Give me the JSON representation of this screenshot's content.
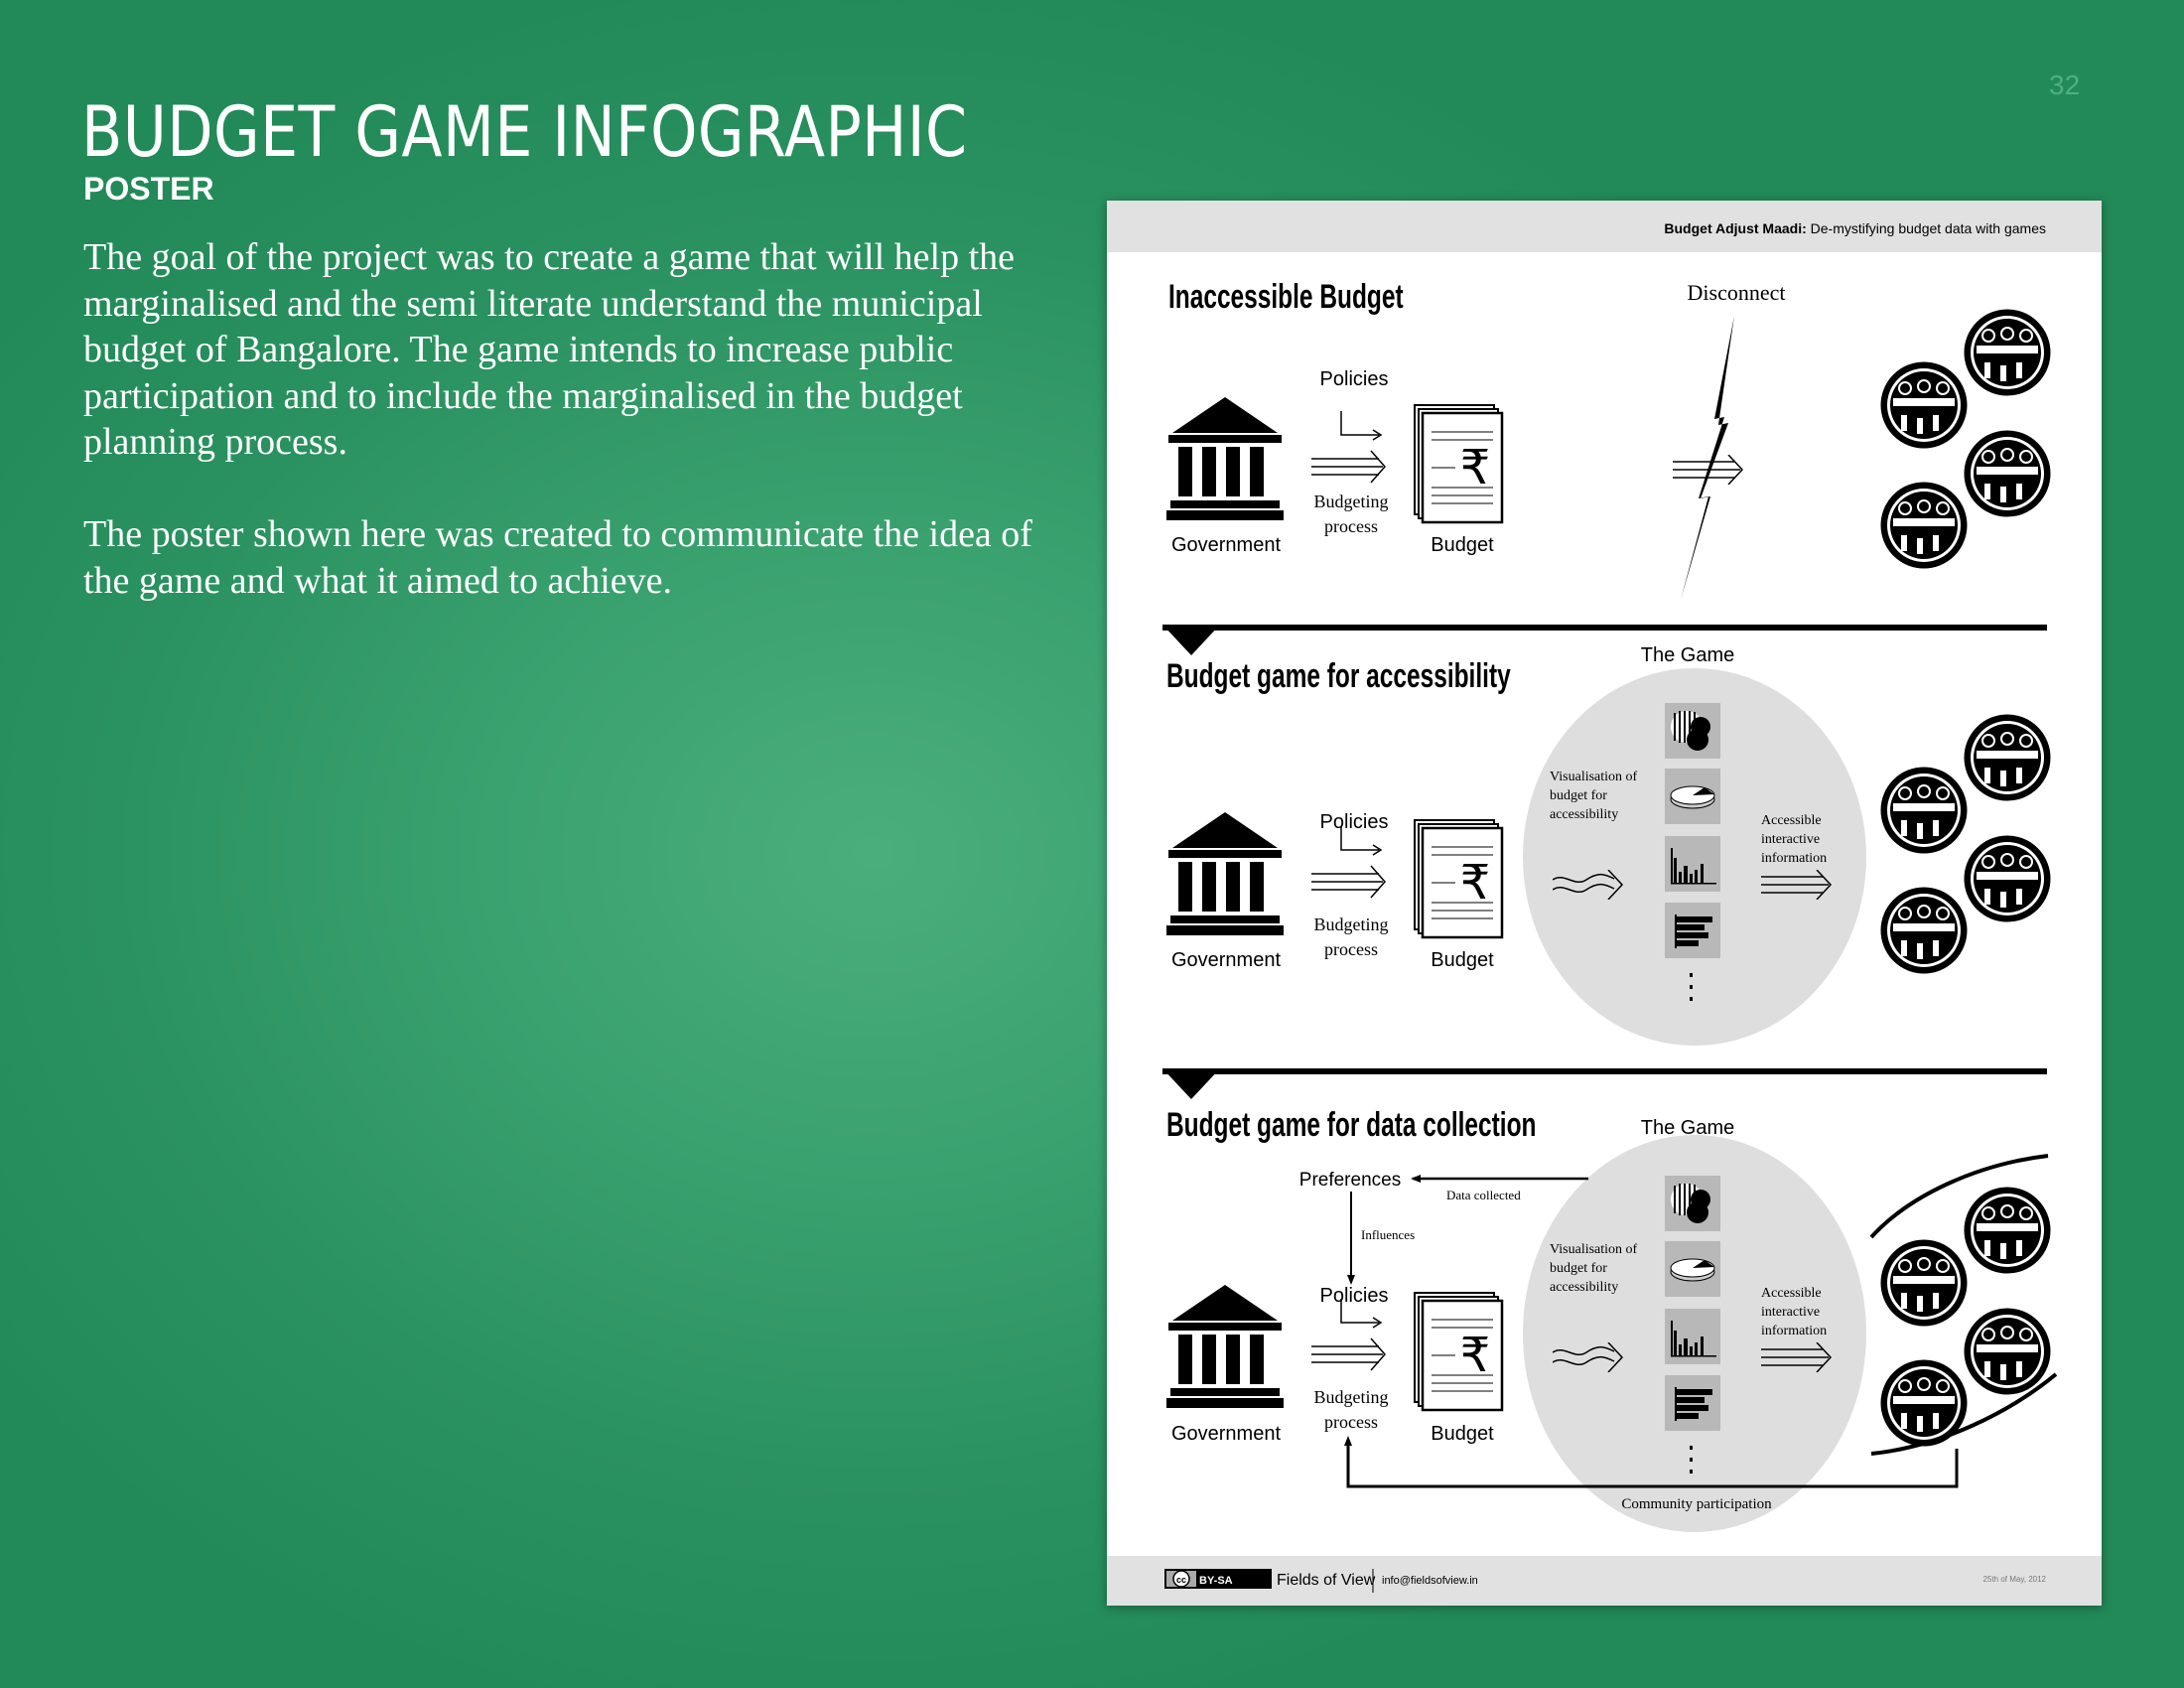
{
  "page": {
    "title": "BUDGET GAME INFOGRAPHIC",
    "subtitle": "POSTER",
    "page_number": "32",
    "paragraphs": [
      "The goal of the project was to create a game that will help the marginalised and the semi literate understand the municipal budget of Bangalore. The game intends to increase public participation and to include the marginalised in the budget planning process.",
      "The poster shown here was created to communicate the idea of the game and what it aimed to achieve."
    ]
  },
  "poster": {
    "header": {
      "bold": "Budget Adjust Maadi:",
      "rest": " De-mystifying budget data with games"
    },
    "section1": {
      "title": "Inaccessible Budget",
      "disconnect": "Disconnect",
      "government": "Government",
      "policies": "Policies",
      "budgeting": "Budgeting",
      "process": "process",
      "budget": "Budget"
    },
    "section2": {
      "title": "Budget game for accessibility",
      "the_game": "The Game",
      "government": "Government",
      "policies": "Policies",
      "budgeting": "Budgeting",
      "process": "process",
      "budget": "Budget",
      "vis_lines": [
        "Visualisation of",
        "budget for",
        "accessibility"
      ],
      "acc_lines": [
        "Accessible",
        "interactive",
        "information"
      ]
    },
    "section3": {
      "title": "Budget game for data collection",
      "the_game": "The Game",
      "preferences": "Preferences",
      "data_collected": "Data collected",
      "influences": "Influences",
      "government": "Government",
      "policies": "Policies",
      "budgeting": "Budgeting",
      "process": "process",
      "budget": "Budget",
      "vis_lines": [
        "Visualisation of",
        "budget for",
        "accessibility"
      ],
      "acc_lines": [
        "Accessible",
        "interactive",
        "information"
      ],
      "community": "Community participation"
    },
    "footer": {
      "license": "BY-SA",
      "cc": "cc",
      "org": "Fields of View",
      "email": "info@fieldsofview.in",
      "date": "25th of May, 2012"
    }
  },
  "colors": {
    "background_green": "#3aa26f",
    "poster_band": "#e1e1e1",
    "game_circle": "#dedede"
  }
}
